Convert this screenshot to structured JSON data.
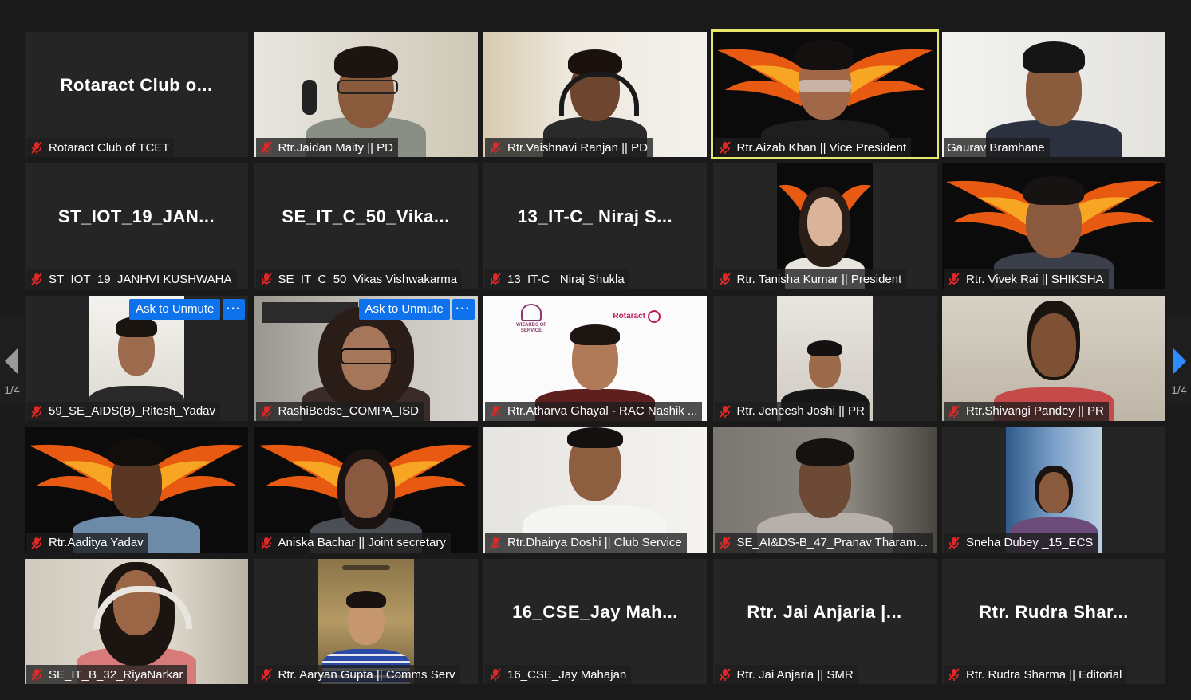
{
  "colors": {
    "background": "#1a1a1a",
    "tile": "#252525",
    "active_speaker_border": "#e6e86a",
    "muted_icon": "#e02828",
    "button_blue": "#0e72ed",
    "nav_arrow_right": "#2d8cff"
  },
  "navigation": {
    "prev_page_indicator": "1/4",
    "next_page_indicator": "1/4"
  },
  "participants": [
    {
      "name": "Rotaract Club of TCET",
      "avatar_text": "Rotaract Club o...",
      "muted": true,
      "video": false
    },
    {
      "name": "Rtr.Jaidan Maity || PD",
      "muted": true,
      "video": true
    },
    {
      "name": "Rtr.Vaishnavi Ranjan || PD",
      "muted": true,
      "video": true
    },
    {
      "name": "Rtr.Aizab Khan || Vice President",
      "muted": true,
      "video": true,
      "active_speaker": true
    },
    {
      "name": "Gaurav Bramhane",
      "muted": false,
      "video": true
    },
    {
      "name": "ST_IOT_19_JANHVI KUSHWAHA",
      "avatar_text": "ST_IOT_19_JAN...",
      "muted": true,
      "video": false
    },
    {
      "name": "SE_IT_C_50_Vikas Vishwakarma",
      "avatar_text": "SE_IT_C_50_Vika...",
      "muted": true,
      "video": false
    },
    {
      "name": "13_IT-C_ Niraj Shukla",
      "avatar_text": "13_IT-C_ Niraj S...",
      "muted": true,
      "video": false
    },
    {
      "name": "Rtr. Tanisha Kumar || President",
      "muted": true,
      "video": true
    },
    {
      "name": "Rtr. Vivek Rai || SHIKSHA",
      "muted": true,
      "video": true
    },
    {
      "name": "59_SE_AIDS(B)_Ritesh_Yadav",
      "muted": true,
      "video": true,
      "unmute_label": "Ask to Unmute",
      "more_label": "···"
    },
    {
      "name": "RashiBedse_COMPA_ISD",
      "muted": true,
      "video": true,
      "unmute_label": "Ask to Unmute",
      "more_label": "···"
    },
    {
      "name": "Rtr.Atharva Ghayal - RAC Nashik ...",
      "muted": true,
      "video": true
    },
    {
      "name": "Rtr. Jeneesh Joshi || PR",
      "muted": true,
      "video": true
    },
    {
      "name": "Rtr.Shivangi Pandey || PR",
      "muted": true,
      "video": true
    },
    {
      "name": "Rtr.Aaditya Yadav",
      "muted": true,
      "video": true
    },
    {
      "name": "Aniska Bachar || Joint secretary",
      "muted": true,
      "video": true
    },
    {
      "name": "Rtr.Dhairya Doshi || Club Service",
      "muted": true,
      "video": true
    },
    {
      "name": "SE_AI&DS-B_47_Pranav Tharamm...",
      "muted": true,
      "video": true
    },
    {
      "name": "Sneha Dubey _15_ECS",
      "muted": true,
      "video": true
    },
    {
      "name": "SE_IT_B_32_RiyaNarkar",
      "muted": true,
      "video": true
    },
    {
      "name": "Rtr. Aaryan Gupta || Comms Serv",
      "muted": true,
      "video": true
    },
    {
      "name": "16_CSE_Jay Mahajan",
      "avatar_text": "16_CSE_Jay  Mah...",
      "muted": true,
      "video": false
    },
    {
      "name": "Rtr. Jai Anjaria || SMR",
      "avatar_text": "Rtr. Jai Anjaria |...",
      "muted": true,
      "video": false
    },
    {
      "name": "Rtr. Rudra Sharma || Editorial",
      "avatar_text": "Rtr. Rudra Shar...",
      "muted": true,
      "video": false
    }
  ],
  "logos": {
    "wizards": "WIZARDS OF SERVICE",
    "rotaract": "Rotaract",
    "rotaract_sub": "NASHIK RAVI HILLS"
  }
}
